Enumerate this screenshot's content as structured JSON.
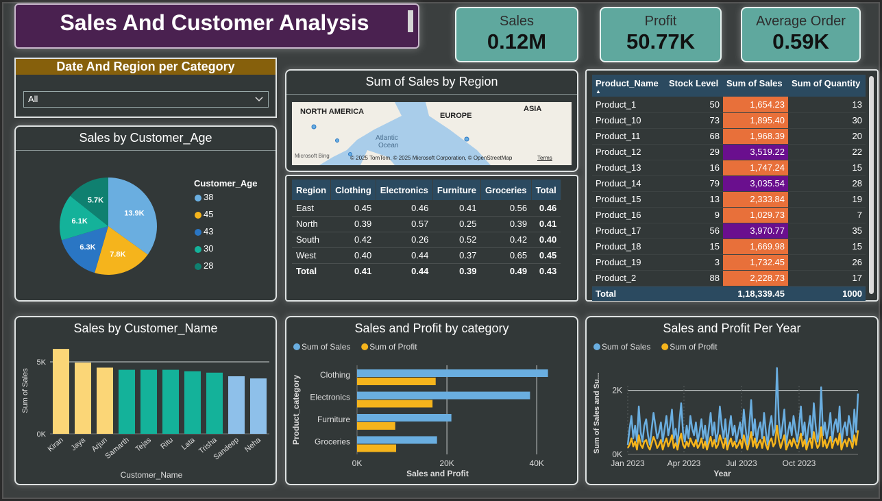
{
  "title": "Sales And Customer Analysis",
  "kpis": [
    {
      "label": "Sales",
      "value": "0.12M"
    },
    {
      "label": "Profit",
      "value": "50.77K"
    },
    {
      "label": "Average Order",
      "value": "0.59K"
    }
  ],
  "slicer": {
    "title": "Date And Region per Category",
    "selected": "All"
  },
  "map": {
    "title": "Sum of Sales by Region",
    "labels": [
      "NORTH AMERICA",
      "EUROPE",
      "ASIA",
      "Atlantic",
      "Ocean"
    ],
    "attribution": "© 2025 TomTom, © 2025 Microsoft Corporation, © OpenStreetMap",
    "terms": "Terms",
    "brand": "Microsoft Bing"
  },
  "region_table": {
    "headers": [
      "Region",
      "Clothing",
      "Electronics",
      "Furniture",
      "Groceries",
      "Total"
    ],
    "rows": [
      [
        "East",
        "0.45",
        "0.46",
        "0.41",
        "0.56",
        "0.46"
      ],
      [
        "North",
        "0.39",
        "0.57",
        "0.25",
        "0.39",
        "0.41"
      ],
      [
        "South",
        "0.42",
        "0.26",
        "0.52",
        "0.42",
        "0.40"
      ],
      [
        "West",
        "0.40",
        "0.44",
        "0.37",
        "0.65",
        "0.45"
      ]
    ],
    "total": [
      "Total",
      "0.41",
      "0.44",
      "0.39",
      "0.49",
      "0.43"
    ]
  },
  "product_table": {
    "headers": [
      "Product_Name",
      "Stock Level",
      "Sum of Sales",
      "Sum of Quantity"
    ],
    "rows": [
      [
        "Product_1",
        "50",
        "1,654.23",
        "13"
      ],
      [
        "Product_10",
        "73",
        "1,895.40",
        "30"
      ],
      [
        "Product_11",
        "68",
        "1,968.39",
        "20"
      ],
      [
        "Product_12",
        "29",
        "3,519.22",
        "22"
      ],
      [
        "Product_13",
        "16",
        "1,747.24",
        "15"
      ],
      [
        "Product_14",
        "79",
        "3,035.54",
        "28"
      ],
      [
        "Product_15",
        "13",
        "2,333.84",
        "19"
      ],
      [
        "Product_16",
        "9",
        "1,029.73",
        "7"
      ],
      [
        "Product_17",
        "56",
        "3,970.77",
        "35"
      ],
      [
        "Product_18",
        "15",
        "1,669.98",
        "15"
      ],
      [
        "Product_19",
        "3",
        "1,732.45",
        "26"
      ],
      [
        "Product_2",
        "88",
        "2,228.73",
        "17"
      ]
    ],
    "total": [
      "Total",
      "",
      "1,18,339.45",
      "1000"
    ],
    "colors": {
      "orange": "#e8703a",
      "purple": "#6a0f8e",
      "header": "#2b4a60"
    }
  },
  "chart_data": [
    {
      "type": "pie",
      "title": "Sales by Customer_Age",
      "legend_title": "Customer_Age",
      "legend_position": "right",
      "slices": [
        {
          "label": "38",
          "value": 13.9,
          "text": "13.9K",
          "color": "#6aaee0"
        },
        {
          "label": "45",
          "value": 7.8,
          "text": "7.8K",
          "color": "#f5b41c"
        },
        {
          "label": "43",
          "value": 6.3,
          "text": "6.3K",
          "color": "#2a76c4"
        },
        {
          "label": "30",
          "value": 6.1,
          "text": "6.1K",
          "color": "#14b29a"
        },
        {
          "label": "28",
          "value": 5.7,
          "text": "5.7K",
          "color": "#0f8070"
        }
      ]
    },
    {
      "type": "bar",
      "title": "Sales by Customer_Name",
      "xlabel": "Customer_Name",
      "ylabel": "Sum of Sales",
      "ylim": [
        0,
        6000
      ],
      "yticks": [
        "0K",
        "5K"
      ],
      "categories": [
        "Kiran",
        "Jaya",
        "Arjun",
        "Samarth",
        "Tejas",
        "Ritu",
        "Lata",
        "Trisha",
        "Sandeep",
        "Neha"
      ],
      "values": [
        5900,
        4950,
        4600,
        4450,
        4450,
        4450,
        4350,
        4250,
        4000,
        3850
      ],
      "colors": [
        "#fbd677",
        "#fbd677",
        "#fbd677",
        "#14b29a",
        "#14b29a",
        "#14b29a",
        "#14b29a",
        "#14b29a",
        "#8ec0ea",
        "#8ec0ea"
      ]
    },
    {
      "type": "bar",
      "orientation": "horizontal",
      "title": "Sales and Profit by category",
      "xlabel": "Sales and Profit",
      "ylabel": "Product_category",
      "legend_position": "top-left",
      "xlim": [
        0,
        45000
      ],
      "xticks": [
        "0K",
        "20K",
        "40K"
      ],
      "categories": [
        "Clothing",
        "Electronics",
        "Furniture",
        "Groceries"
      ],
      "series": [
        {
          "name": "Sum of Sales",
          "color": "#6aaee0",
          "values": [
            42500,
            38500,
            21000,
            17800
          ]
        },
        {
          "name": "Sum of Profit",
          "color": "#f5b41c",
          "values": [
            17500,
            16800,
            8500,
            8700
          ]
        }
      ]
    },
    {
      "type": "line",
      "title": "Sales and Profit Per Year",
      "xlabel": "Year",
      "ylabel": "Sum of Sales and Su...",
      "legend_position": "top-left",
      "ylim": [
        0,
        3000
      ],
      "yticks": [
        "0K",
        "2K"
      ],
      "xticks": [
        "Jan 2023",
        "Apr 2023",
        "Jul 2023",
        "Oct 2023"
      ],
      "series": [
        {
          "name": "Sum of Sales",
          "color": "#6aaee0",
          "values": [
            300,
            800,
            1200,
            500,
            900,
            400,
            1500,
            700,
            400,
            900,
            1100,
            600,
            300,
            800,
            1300,
            900,
            500,
            700,
            1000,
            400,
            800,
            1200,
            600,
            900,
            1400,
            500,
            800,
            300,
            1000,
            1600,
            700,
            400,
            900,
            500,
            1200,
            800,
            600,
            1000,
            400,
            700,
            1100,
            500,
            900,
            300,
            800,
            1300,
            600,
            1000,
            400,
            700,
            1500,
            900,
            500,
            1100,
            300,
            800,
            1200,
            600,
            900,
            400,
            700,
            1000,
            500,
            1400,
            800,
            300,
            900,
            1700,
            600,
            1100,
            400,
            800,
            1000,
            500,
            1300,
            700,
            300,
            900,
            1200,
            600,
            800,
            2700,
            1100,
            500,
            900,
            1400,
            300,
            700,
            1000,
            600,
            1200,
            800,
            400,
            900,
            1500,
            600,
            1000,
            300,
            800,
            1200,
            500,
            1600,
            900,
            400,
            700,
            2100,
            600,
            1000,
            500,
            800,
            1300,
            400,
            900,
            1100,
            700,
            1500,
            300,
            800,
            1000,
            600,
            1200,
            900,
            400,
            1400,
            700,
            1900
          ]
        },
        {
          "name": "Sum of Profit",
          "color": "#f5b41c",
          "values": [
            200,
            300,
            500,
            250,
            400,
            150,
            600,
            300,
            200,
            400,
            450,
            250,
            150,
            350,
            550,
            400,
            200,
            300,
            450,
            150,
            350,
            500,
            250,
            400,
            600,
            200,
            350,
            150,
            450,
            650,
            300,
            200,
            400,
            250,
            500,
            350,
            250,
            450,
            200,
            300,
            500,
            200,
            400,
            150,
            350,
            550,
            250,
            450,
            200,
            300,
            600,
            400,
            200,
            500,
            150,
            350,
            500,
            250,
            400,
            200,
            300,
            450,
            200,
            600,
            350,
            150,
            400,
            700,
            250,
            500,
            200,
            350,
            450,
            200,
            550,
            300,
            150,
            400,
            500,
            250,
            350,
            900,
            450,
            200,
            400,
            600,
            150,
            300,
            450,
            250,
            500,
            350,
            200,
            400,
            650,
            250,
            450,
            150,
            350,
            500,
            200,
            700,
            400,
            200,
            300,
            850,
            250,
            450,
            200,
            350,
            550,
            200,
            400,
            500,
            300,
            650,
            150,
            350,
            450,
            250,
            500,
            400,
            200,
            600,
            300,
            750
          ]
        }
      ]
    }
  ]
}
